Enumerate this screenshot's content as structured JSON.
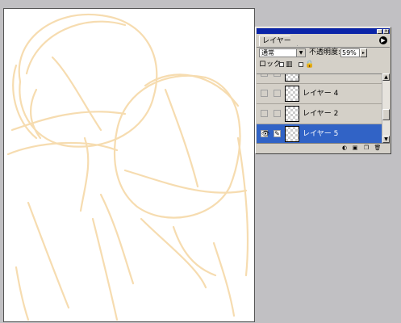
{
  "panel": {
    "tab_label": "レイヤー",
    "menu_icon": "play-icon",
    "blend_mode": "通常",
    "opacity_label": "不透明度:",
    "opacity_value": "59%",
    "lock_label": "ロック:",
    "layers": [
      {
        "name": "",
        "visible": false,
        "selected": false
      },
      {
        "name": "レイヤー 4",
        "visible": false,
        "selected": false
      },
      {
        "name": "レイヤー 2",
        "visible": false,
        "selected": false
      },
      {
        "name": "レイヤー 5",
        "visible": true,
        "selected": true
      }
    ]
  },
  "colors": {
    "background": "#c1c0c3",
    "title_bar": "#0a24a8",
    "selected_row": "#3163c6",
    "sketch_stroke": "#f6d9a8"
  }
}
